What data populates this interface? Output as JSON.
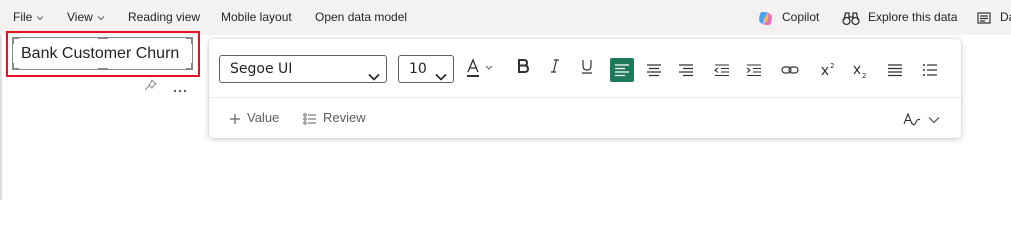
{
  "menu": {
    "file": "File",
    "view": "View",
    "reading_view": "Reading view",
    "mobile_layout": "Mobile layout",
    "open_data_model": "Open data model",
    "copilot": "Copilot",
    "explore": "Explore this data",
    "truncated": "Da"
  },
  "textbox": {
    "content": "Bank Customer Churn"
  },
  "format_toolbar": {
    "font_family": "Segoe UI",
    "font_size": "10",
    "alignment_selected": "left",
    "value_label": "Value",
    "review_label": "Review"
  },
  "colors": {
    "menubar_bg": "#f3f2f1",
    "accent": "#1f7a5c",
    "highlight": "#e81123"
  },
  "icons": [
    "chevron-down-icon",
    "copilot-icon",
    "binoculars-icon",
    "dataset-icon",
    "pin-icon",
    "more-icon",
    "font-color-icon",
    "bold-icon",
    "italic-icon",
    "underline-icon",
    "align-left-icon",
    "align-center-icon",
    "align-right-icon",
    "decrease-indent-icon",
    "increase-indent-icon",
    "link-icon",
    "superscript-icon",
    "subscript-icon",
    "bullet-list-icon",
    "numbered-list-icon",
    "plus-icon",
    "review-list-icon",
    "spellcheck-icon"
  ]
}
